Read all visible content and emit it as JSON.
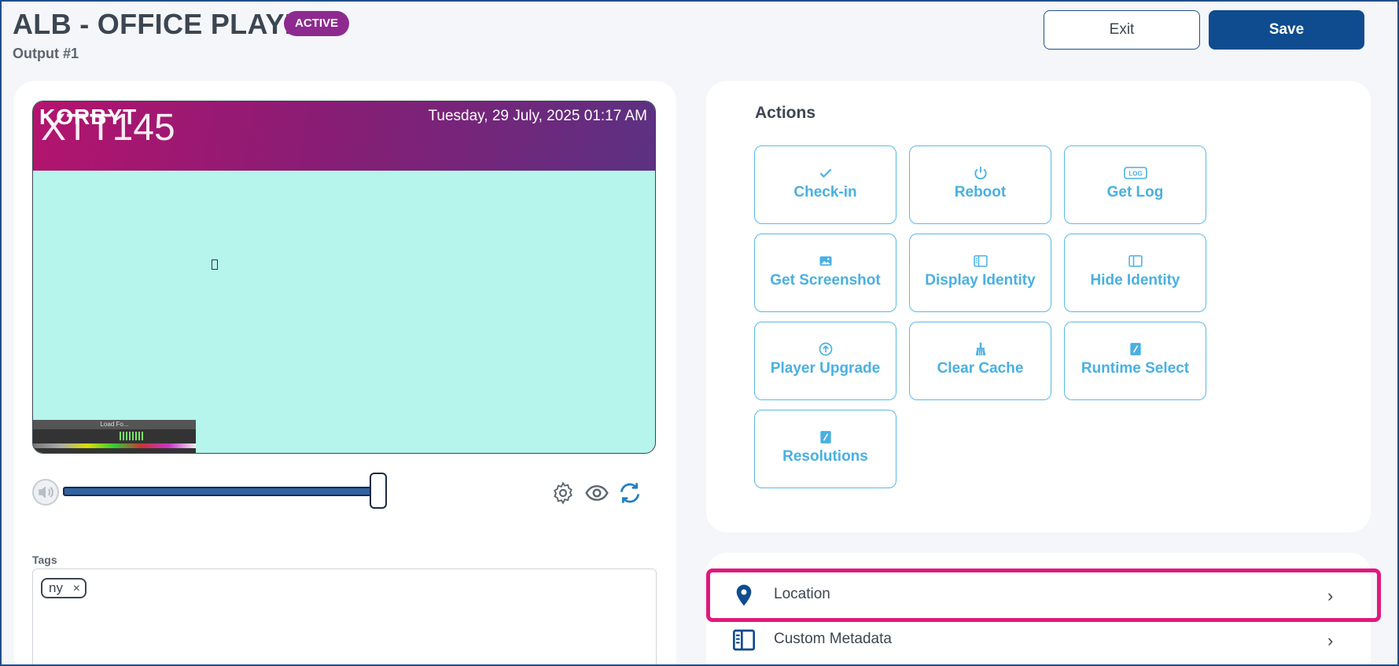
{
  "header": {
    "title": "ALB - OFFICE PLAYER",
    "status_badge": "ACTIVE",
    "subtitle": "Output #1",
    "exit_label": "Exit",
    "save_label": "Save"
  },
  "preview": {
    "logo": "KORBYT",
    "player_code": "XTT145",
    "datetime": "Tuesday, 29 July, 2025 01:17 AM",
    "loading_text": "Load Fo..."
  },
  "volume": {
    "level_fraction": 0.96
  },
  "tags": {
    "label": "Tags",
    "items": [
      {
        "label": "ny",
        "remove": "×"
      }
    ]
  },
  "actions": {
    "title": "Actions",
    "items": [
      {
        "label": "Check-in",
        "icon": "check-icon"
      },
      {
        "label": "Reboot",
        "icon": "power-icon"
      },
      {
        "label": "Get Log",
        "icon": "log-icon"
      },
      {
        "label": "Get Screenshot",
        "icon": "image-icon"
      },
      {
        "label": "Display Identity",
        "icon": "identity-panel-icon"
      },
      {
        "label": "Hide Identity",
        "icon": "sidebar-panel-icon"
      },
      {
        "label": "Player Upgrade",
        "icon": "upload-circle-icon"
      },
      {
        "label": "Clear Cache",
        "icon": "broom-icon"
      },
      {
        "label": "Runtime Select",
        "icon": "edit-icon"
      },
      {
        "label": "Resolutions",
        "icon": "edit-icon"
      }
    ]
  },
  "settings_rows": [
    {
      "label": "Location",
      "icon": "location-pin-icon",
      "chevron": "›"
    },
    {
      "label": "Custom Metadata",
      "icon": "metadata-panel-icon",
      "chevron": "›"
    }
  ],
  "colors": {
    "brand_primary": "#0f4c8f",
    "badge_active": "#8e2a8f",
    "action_accent": "#48b0e2",
    "highlight": "#e0197d"
  }
}
